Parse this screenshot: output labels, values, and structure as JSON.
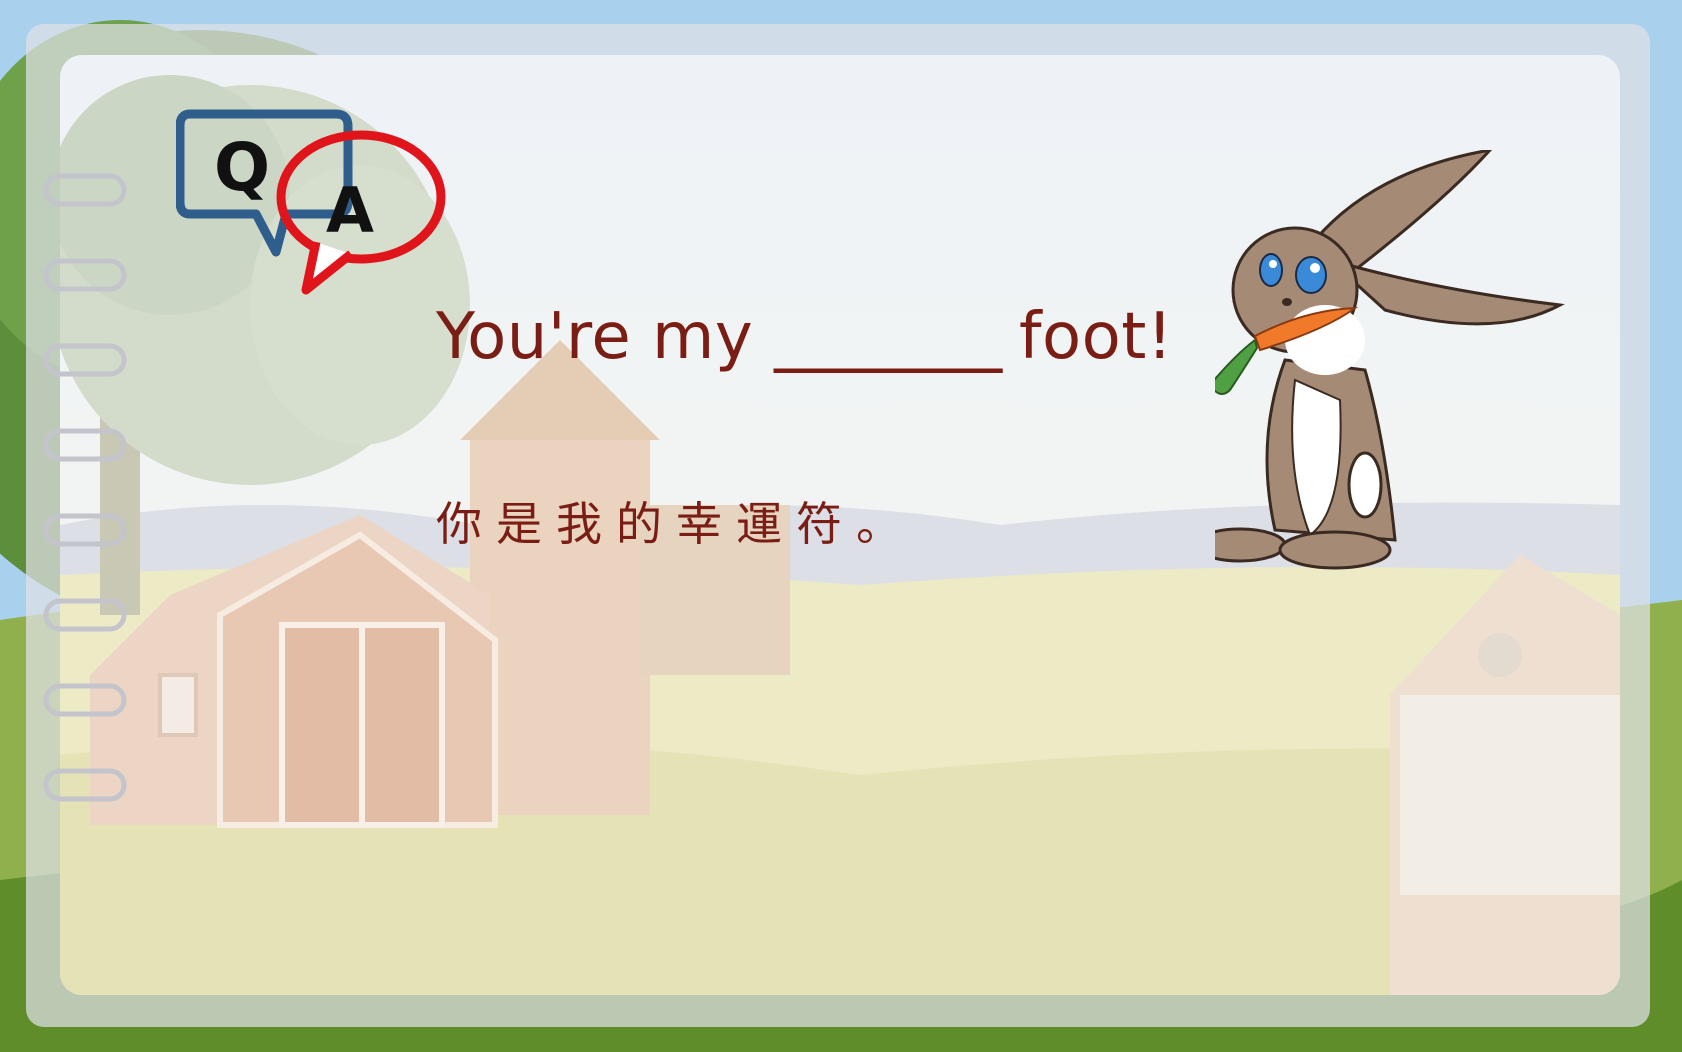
{
  "qa_logo": {
    "q_letter": "Q",
    "a_letter": "A"
  },
  "question": {
    "before": "You're my",
    "blank": "________",
    "after": "foot!"
  },
  "translation": "你是我的幸運符。",
  "colors": {
    "text": "#7a1e15",
    "q_bubble": "#2f5d8c",
    "a_bubble": "#e0141b"
  },
  "icons": {
    "logo": "qa-speech-bubbles-icon",
    "character": "rabbit-with-carrot-illustration"
  }
}
